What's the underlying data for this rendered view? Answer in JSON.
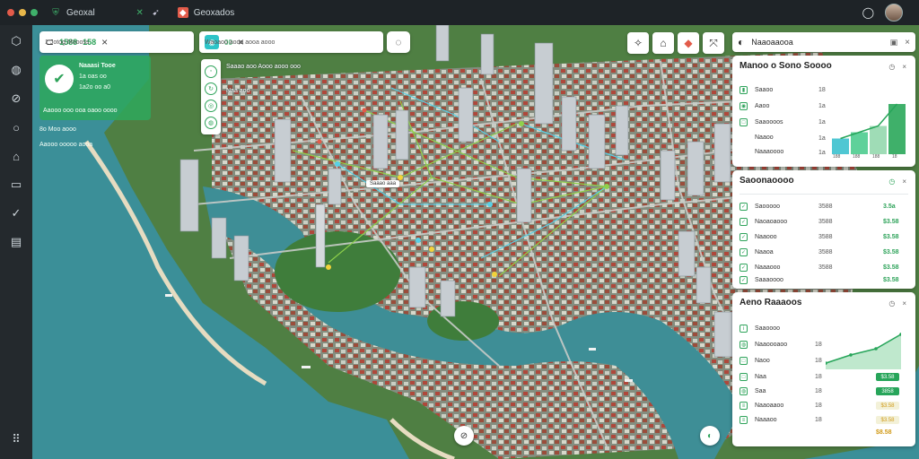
{
  "topbar": {
    "tab1": "Geoxal",
    "tab1_icon": "shield-icon",
    "tab2_icon": "map-icon",
    "tab3": "Geoxados",
    "tab3_icon": "app-icon",
    "colors": {
      "red": "#e25b4a",
      "yellow": "#e8b74a",
      "green": "#3fb06a"
    }
  },
  "rail": {
    "items": [
      "cube-icon",
      "globe-icon",
      "compass-icon",
      "circle-icon",
      "home-icon",
      "folder-icon",
      "check-icon",
      "document-icon"
    ],
    "bottom": "grid-icon"
  },
  "search": {
    "value": "1 Jotog Moooss",
    "badge1": "1588",
    "badge2": "158",
    "close": "×"
  },
  "location_card": {
    "line1": "Naaasi Tooe",
    "line2": "1a oas oo",
    "line3": "1a2o oo a0",
    "footer": "Aaooo ooo ooa oaoo oooo",
    "meta1": "8o Moo aooo",
    "meta2": "Aaooo ooooo aooa"
  },
  "center_search": {
    "value": "Waoaoo aooa aooa aooo",
    "badge": "00",
    "close": "×"
  },
  "map_legend": {
    "line1": "Saaao aoo Aooo aooo ooo",
    "line2": "Naa aoo"
  },
  "pin_label": "Saaao aaa",
  "top_tools": [
    "route-icon",
    "save-icon",
    "layers-icon",
    "expand-icon"
  ],
  "right_head": {
    "title": "Naaoaaooa",
    "icons": [
      "settings-icon",
      "close-icon"
    ]
  },
  "card1": {
    "title": "Manoo o Sono Soooo",
    "rows": [
      {
        "label": "Saaoo",
        "val": "18"
      },
      {
        "label": "Aaoo",
        "val": "1a"
      },
      {
        "label": "Saaoooos",
        "val": "1a"
      },
      {
        "label": "Naaoo",
        "val": "1a"
      },
      {
        "label": "Naaaoooo",
        "val": "1a"
      }
    ],
    "axis": [
      "188",
      "188",
      "188",
      "18"
    ],
    "chart": [
      0.25,
      0.35,
      0.45,
      0.8
    ]
  },
  "card2": {
    "title": "Saoonaoooo",
    "rows": [
      {
        "label": "Saooooo",
        "v1": "3588",
        "v2": "3.5a"
      },
      {
        "label": "Naoaoaooo",
        "v1": "3588",
        "v2": "$3.58"
      },
      {
        "label": "Naaooo",
        "v1": "3588",
        "v2": "$3.58"
      },
      {
        "label": "Naaoa",
        "v1": "3588",
        "v2": "$3.58"
      },
      {
        "label": "Naaaooo",
        "v1": "3588",
        "v2": "$3.58"
      },
      {
        "label": "Saaaoooo",
        "v1": "",
        "v2": "$3.58"
      }
    ]
  },
  "card3": {
    "title": "Aeno Raaaoos",
    "rows": [
      {
        "label": "Saaoooo",
        "v1": "",
        "pill": ""
      },
      {
        "label": "Naaoooaoo",
        "v1": "18",
        "pill": ""
      },
      {
        "label": "Naoo",
        "v1": "18",
        "pill": "$3.58"
      },
      {
        "label": "Naa",
        "v1": "18",
        "pill": "3858"
      },
      {
        "label": "Saa",
        "v1": "18",
        "pill": "$8.58"
      },
      {
        "label": "Naaoaaoo",
        "v1": "18",
        "pill": "$3.58"
      },
      {
        "label": "Naaaoo",
        "v1": "18",
        "pill": "$3.58"
      }
    ],
    "chart": [
      0.15,
      0.35,
      0.5,
      0.85
    ]
  },
  "map_buttons": {
    "compass": "compass-icon",
    "locate": "locate-icon"
  }
}
